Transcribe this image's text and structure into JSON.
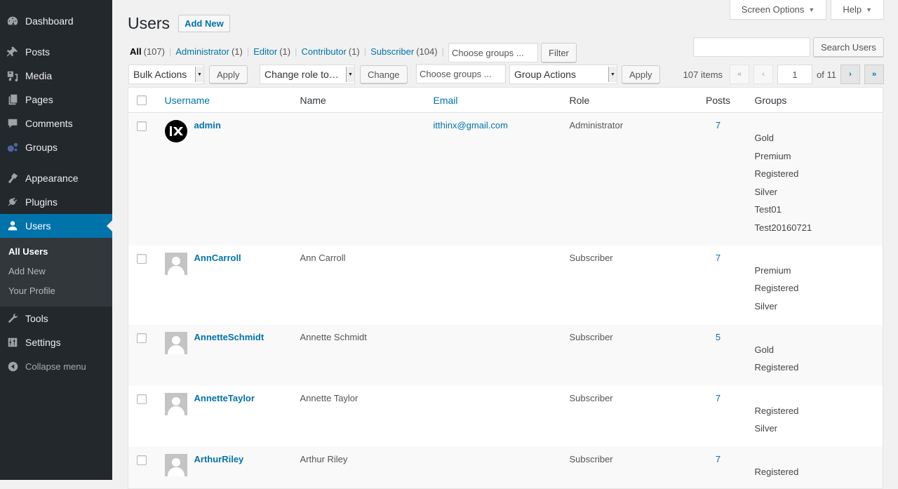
{
  "sidebar": {
    "items": [
      {
        "label": "Dashboard",
        "icon": "dashboard-icon"
      },
      {
        "label": "Posts",
        "icon": "pin-icon"
      },
      {
        "label": "Media",
        "icon": "media-icon"
      },
      {
        "label": "Pages",
        "icon": "pages-icon"
      },
      {
        "label": "Comments",
        "icon": "comment-icon"
      },
      {
        "label": "Groups",
        "icon": "groups-icon"
      },
      {
        "label": "Appearance",
        "icon": "paintbrush-icon"
      },
      {
        "label": "Plugins",
        "icon": "plugin-icon"
      },
      {
        "label": "Users",
        "icon": "user-icon"
      },
      {
        "label": "Tools",
        "icon": "wrench-icon"
      },
      {
        "label": "Settings",
        "icon": "settings-icon"
      }
    ],
    "submenu": [
      "All Users",
      "Add New",
      "Your Profile"
    ],
    "collapse_label": "Collapse menu"
  },
  "header": {
    "screen_options": "Screen Options",
    "help": "Help",
    "title": "Users",
    "add_new": "Add New"
  },
  "filters": {
    "views": [
      {
        "label": "All",
        "count": "(107)"
      },
      {
        "label": "Administrator",
        "count": "(1)"
      },
      {
        "label": "Editor",
        "count": "(1)"
      },
      {
        "label": "Contributor",
        "count": "(1)"
      },
      {
        "label": "Subscriber",
        "count": "(104)"
      }
    ],
    "groups_placeholder": "Choose groups ...",
    "filter_button": "Filter"
  },
  "search": {
    "value": "",
    "button": "Search Users"
  },
  "bulk": {
    "bulk_actions": "Bulk Actions",
    "apply": "Apply",
    "change_role": "Change role to…",
    "change": "Change",
    "groups_placeholder": "Choose groups ...",
    "group_actions": "Group Actions",
    "apply2": "Apply"
  },
  "pagination": {
    "items": "107 items",
    "first": "«",
    "prev": "‹",
    "current": "1",
    "of": "of 11",
    "next": "›",
    "last": "»"
  },
  "table": {
    "columns": [
      "Username",
      "Name",
      "Email",
      "Role",
      "Posts",
      "Groups"
    ],
    "rows": [
      {
        "username": "admin",
        "name": "",
        "email": "itthinx@gmail.com",
        "role": "Administrator",
        "posts": "7",
        "groups": [
          "Gold",
          "Premium",
          "Registered",
          "Silver",
          "Test01",
          "Test20160721"
        ],
        "avatar": "custom"
      },
      {
        "username": "AnnCarroll",
        "name": "Ann Carroll",
        "email": "",
        "role": "Subscriber",
        "posts": "7",
        "groups": [
          "Premium",
          "Registered",
          "Silver"
        ],
        "avatar": "default"
      },
      {
        "username": "AnnetteSchmidt",
        "name": "Annette Schmidt",
        "email": "",
        "role": "Subscriber",
        "posts": "5",
        "groups": [
          "Gold",
          "Registered"
        ],
        "avatar": "default"
      },
      {
        "username": "AnnetteTaylor",
        "name": "Annette Taylor",
        "email": "",
        "role": "Subscriber",
        "posts": "7",
        "groups": [
          "Registered",
          "Silver"
        ],
        "avatar": "default"
      },
      {
        "username": "ArthurRiley",
        "name": "Arthur Riley",
        "email": "",
        "role": "Subscriber",
        "posts": "7",
        "groups": [
          "Registered"
        ],
        "avatar": "default"
      }
    ]
  },
  "colors": {
    "accent": "#0073aa",
    "sidebar": "#23282d",
    "submenu": "#32373c"
  }
}
